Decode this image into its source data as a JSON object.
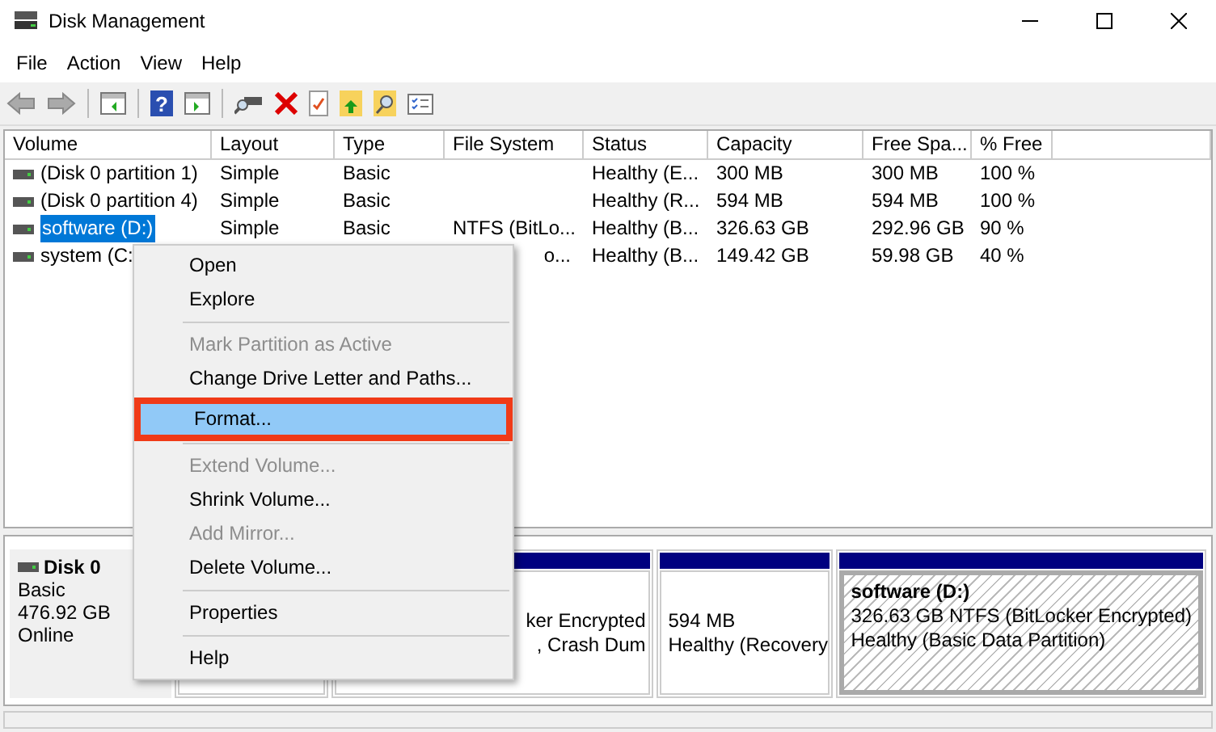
{
  "window": {
    "title": "Disk Management"
  },
  "menu_bar": [
    "File",
    "Action",
    "View",
    "Help"
  ],
  "toolbar": {
    "help_icon": "?"
  },
  "table": {
    "columns": [
      "Volume",
      "Layout",
      "Type",
      "File System",
      "Status",
      "Capacity",
      "Free Spa...",
      "% Free"
    ],
    "rows": [
      {
        "volume": "(Disk 0 partition 1)",
        "layout": "Simple",
        "type": "Basic",
        "status": "Healthy (E...",
        "capacity": "300 MB",
        "free": "300 MB",
        "pct": "100 %",
        "selected": false
      },
      {
        "volume": "(Disk 0 partition 4)",
        "layout": "Simple",
        "type": "Basic",
        "status": "Healthy (R...",
        "capacity": "594 MB",
        "free": "594 MB",
        "pct": "100 %",
        "selected": false
      },
      {
        "volume": "software (D:)",
        "layout": "Simple",
        "type": "Basic",
        "file_system": "NTFS (BitLo...",
        "status": "Healthy (B...",
        "capacity": "326.63 GB",
        "free": "292.96 GB",
        "pct": "90 %",
        "selected": true
      },
      {
        "volume": "system (C:",
        "file_system": "o...",
        "status": "Healthy (B...",
        "capacity": "149.42 GB",
        "free": "59.98 GB",
        "pct": "40 %",
        "selected": false
      }
    ]
  },
  "context_menu": [
    {
      "kind": "item",
      "label": "Open",
      "disabled": false,
      "selected": false
    },
    {
      "kind": "item",
      "label": "Explore",
      "disabled": false,
      "selected": false
    },
    {
      "kind": "separator"
    },
    {
      "kind": "item",
      "label": "Mark Partition as Active",
      "disabled": true,
      "selected": false
    },
    {
      "kind": "item",
      "label": "Change Drive Letter and Paths...",
      "disabled": false,
      "selected": false
    },
    {
      "kind": "item",
      "label": "Format...",
      "disabled": false,
      "selected": true
    },
    {
      "kind": "separator"
    },
    {
      "kind": "item",
      "label": "Extend Volume...",
      "disabled": true,
      "selected": false
    },
    {
      "kind": "item",
      "label": "Shrink Volume...",
      "disabled": false,
      "selected": false
    },
    {
      "kind": "item",
      "label": "Add Mirror...",
      "disabled": true,
      "selected": false
    },
    {
      "kind": "item",
      "label": "Delete Volume...",
      "disabled": false,
      "selected": false
    },
    {
      "kind": "separator"
    },
    {
      "kind": "item",
      "label": "Properties",
      "disabled": false,
      "selected": false
    },
    {
      "kind": "separator"
    },
    {
      "kind": "item",
      "label": "Help",
      "disabled": false,
      "selected": false
    }
  ],
  "disk": {
    "name": "Disk 0",
    "lines": [
      "Basic",
      "476.92 GB",
      "Online"
    ],
    "partitions": [
      {
        "lines": [
          "ker Encrypted",
          ", Crash Dum"
        ],
        "selected": false
      },
      {
        "lines": [
          "594 MB",
          "Healthy (Recovery"
        ],
        "selected": false
      },
      {
        "name": "software  (D:)",
        "lines": [
          "326.63 GB NTFS (BitLocker Encrypted)",
          "Healthy (Basic Data Partition)"
        ],
        "selected": true
      }
    ]
  }
}
